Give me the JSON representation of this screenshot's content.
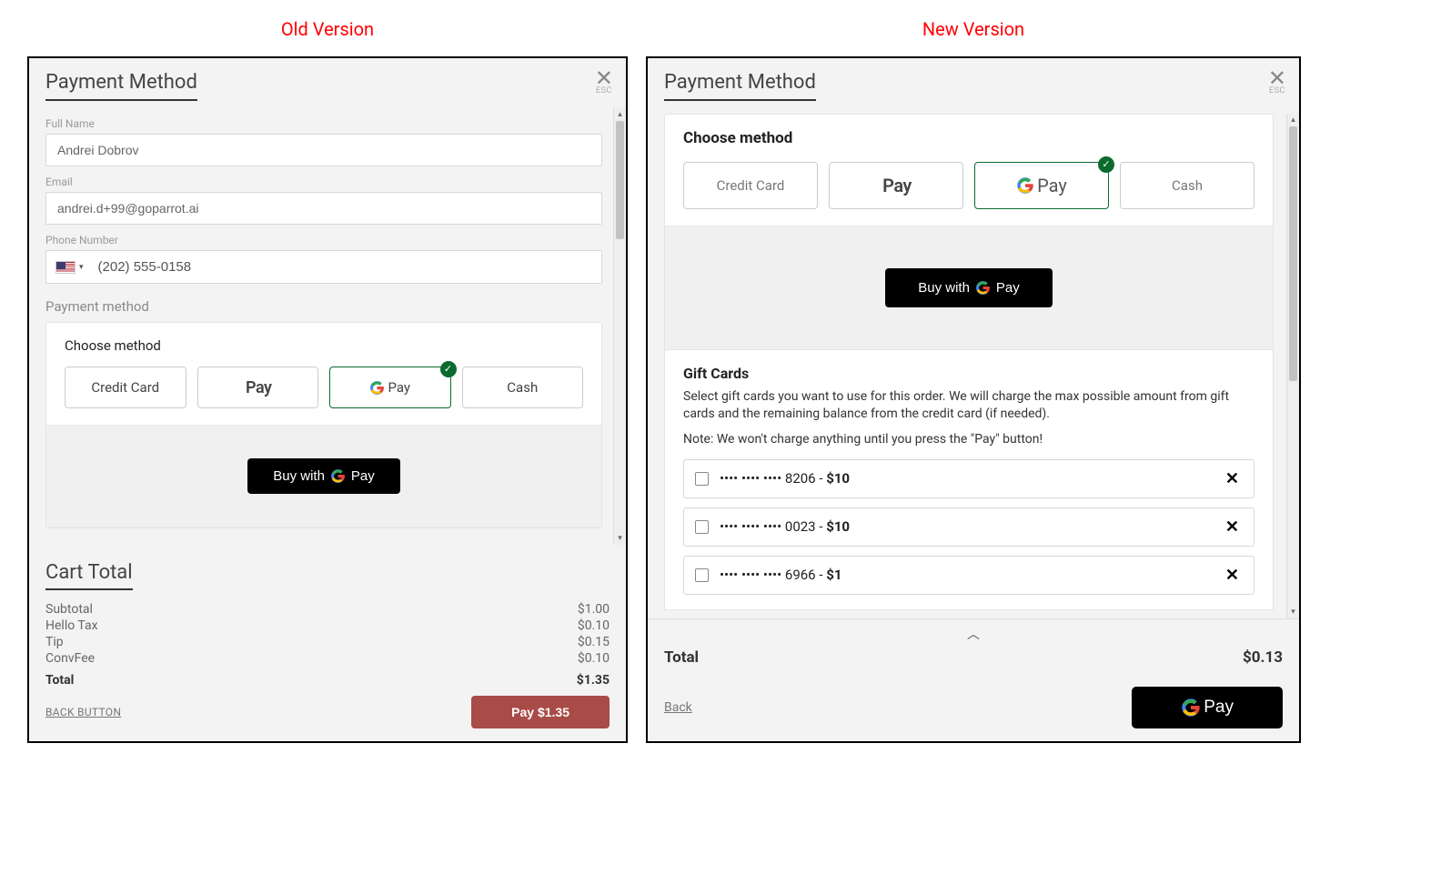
{
  "labels": {
    "old": "Old Version",
    "new": "New Version"
  },
  "old": {
    "title": "Payment Method",
    "close_hint": "ESC",
    "fields": {
      "full_name_label": "Full Name",
      "full_name_value": "Andrei Dobrov",
      "email_label": "Email",
      "email_value": "andrei.d+99@goparrot.ai",
      "phone_label": "Phone Number",
      "phone_value": "(202) 555-0158"
    },
    "payment_method_heading": "Payment method",
    "choose_label": "Choose method",
    "methods": {
      "credit": "Credit Card",
      "apple": "Pay",
      "google": "Pay",
      "cash": "Cash",
      "selected": "google"
    },
    "buy_with": "Buy with",
    "cart_title": "Cart Total",
    "lines": [
      {
        "label": "Subtotal",
        "value": "$1.00"
      },
      {
        "label": "Hello Tax",
        "value": "$0.10"
      },
      {
        "label": "Tip",
        "value": "$0.15"
      },
      {
        "label": "ConvFee",
        "value": "$0.10"
      }
    ],
    "total_label": "Total",
    "total_value": "$1.35",
    "back_label": "BACK BUTTON",
    "pay_button": "Pay $1.35"
  },
  "new": {
    "title": "Payment Method",
    "close_hint": "ESC",
    "choose_label": "Choose method",
    "methods": {
      "credit": "Credit Card",
      "apple": "Pay",
      "google": "Pay",
      "cash": "Cash",
      "selected": "google"
    },
    "buy_with": "Buy with",
    "gift": {
      "title": "Gift Cards",
      "desc": "Select gift cards you want to use for this order. We will charge the max possible amount from gift cards and the remaining balance from the credit card (if needed).",
      "note": "Note: We won't charge anything until you press the \"Pay\" button!",
      "cards": [
        {
          "masked": "•••• •••• •••• 8206",
          "amount": "$10"
        },
        {
          "masked": "•••• •••• •••• 0023",
          "amount": "$10"
        },
        {
          "masked": "•••• •••• •••• 6966",
          "amount": "$1"
        }
      ]
    },
    "total_label": "Total",
    "total_value": "$0.13",
    "back_label": "Back",
    "pay_brand": "Pay"
  }
}
